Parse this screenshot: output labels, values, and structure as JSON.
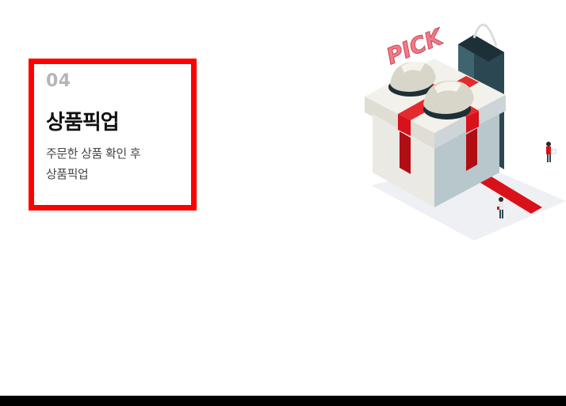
{
  "step": {
    "number": "04",
    "title": "상품픽업",
    "description_line1": "주문한 상품 확인 후",
    "description_line2": "상품픽업"
  },
  "illustration": {
    "sign_text": "PICK",
    "icon": "gift-box-pickup-illustration"
  },
  "colors": {
    "highlight_border": "#ff0000",
    "step_number": "#b5b5b5",
    "ribbon": "#d9111a",
    "bag": "#2b4852",
    "bottom_bar": "#000000"
  }
}
